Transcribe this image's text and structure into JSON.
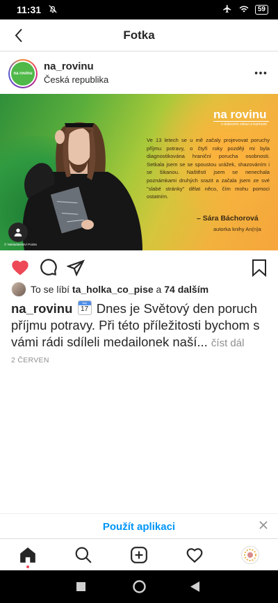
{
  "status_bar": {
    "time": "11:31",
    "battery": "59"
  },
  "header": {
    "title": "Fotka"
  },
  "post": {
    "username": "na_rovinu",
    "location": "Česká republika",
    "avatar_text": "na rovinu",
    "image": {
      "logo": "na rovinu",
      "logo_sub": "o duševním zdraví a harmonii",
      "quote": "Ve 13 letech se u mě začaly projevovat poruchy příjmu potravy, o čtyři roky později mi byla diagnostikována hraniční porucha osobnosti. Setkala jsem se se spoustou urážek, shazováním i se šikanou. Naštěstí jsem se nenechala poznámkami druhých srazit a začala jsem ze své \"slabé stránky\" dělat něco, čím mohu pomoci ostatním.",
      "author": "– Sára Báchorová",
      "author_role": "autorka knihy An(n)a",
      "credit": "© Nakladatelství Pointa"
    },
    "likes": {
      "prefix": "To se líbí",
      "liker": "ta_holka_co_pise",
      "connector": "a",
      "others": "74 dalším"
    },
    "caption": {
      "username": "na_rovinu",
      "calendar_month": "July",
      "calendar_day": "17",
      "text": "Dnes je Světový den poruch příjmu potravy. Při této příležitosti bychom s vámi rádi sdíleli medailonek naší...",
      "more": "číst dál"
    },
    "date": "2 ČERVEN"
  },
  "use_app": {
    "label": "Použít aplikaci"
  },
  "colors": {
    "like": "#ed4956",
    "link": "#0095f6",
    "muted": "#8e8e8e"
  }
}
